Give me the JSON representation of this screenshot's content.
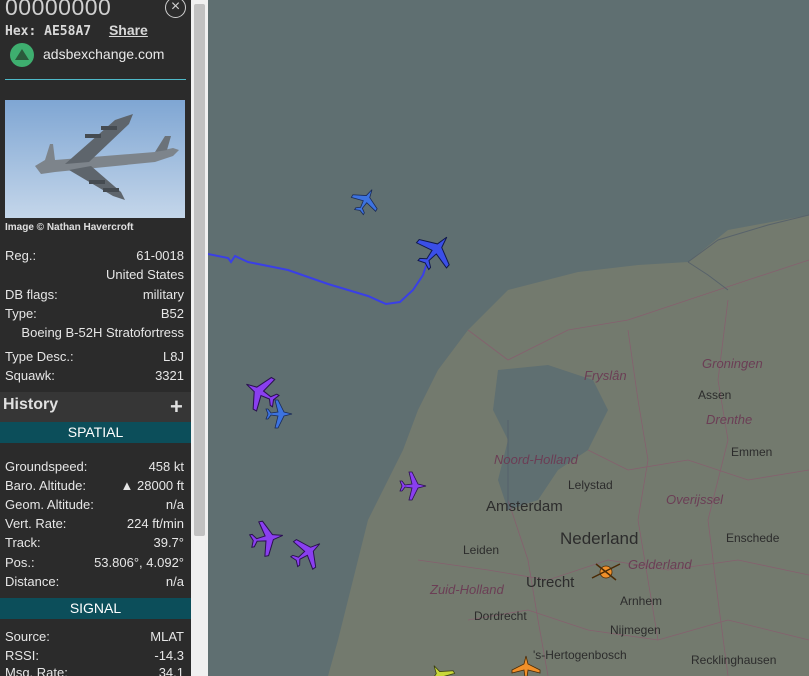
{
  "sidebar": {
    "callsign": "00000000",
    "hex_label": "Hex:",
    "hex": "AE58A7",
    "share": "Share",
    "site": "adsbexchange.com",
    "photo_credit": "Image © Nathan Havercroft",
    "info": [
      {
        "label": "Reg.:",
        "value": "61-0018"
      },
      {
        "label": "",
        "value": "United States"
      },
      {
        "label": "DB flags:",
        "value": "military"
      },
      {
        "label": "Type:",
        "value": "B52"
      },
      {
        "label": "",
        "value": "Boeing B-52H Stratofortress"
      },
      {
        "label": "Type Desc.:",
        "value": "L8J"
      },
      {
        "label": "Squawk:",
        "value": "3321"
      }
    ],
    "history": {
      "title": "History",
      "toggle": "+"
    },
    "spatial": {
      "title": "SPATIAL",
      "rows": [
        {
          "label": "Groundspeed:",
          "value": "458 kt"
        },
        {
          "label": "Baro. Altitude:",
          "value": "▲ 28000 ft"
        },
        {
          "label": "Geom. Altitude:",
          "value": "n/a"
        },
        {
          "label": "Vert. Rate:",
          "value": "224 ft/min"
        },
        {
          "label": "Track:",
          "value": "39.7°"
        },
        {
          "label": "Pos.:",
          "value": "53.806°, 4.092°"
        },
        {
          "label": "Distance:",
          "value": "n/a"
        }
      ]
    },
    "signal": {
      "title": "SIGNAL",
      "rows": [
        {
          "label": "Source:",
          "value": "MLAT"
        },
        {
          "label": "RSSI:",
          "value": "-14.3"
        },
        {
          "label": "Msg. Rate:",
          "value": "34.1"
        }
      ]
    }
  },
  "map": {
    "labels": {
      "frysian": "Fryslân",
      "groningen": "Groningen",
      "assen": "Assen",
      "drenthe": "Drenthe",
      "emmen": "Emmen",
      "noord_holland": "Noord-Holland",
      "lelystad": "Lelystad",
      "overijssel": "Overijssel",
      "amsterdam": "Amsterdam",
      "nederland": "Nederland",
      "enschede": "Enschede",
      "leiden": "Leiden",
      "utrecht": "Utrecht",
      "gelderland": "Gelderland",
      "zuid_holland": "Zuid-Holland",
      "arnhem": "Arnhem",
      "dordrecht": "Dordrecht",
      "nijmegen": "Nijmegen",
      "hertogenbosch": "'s-Hertogenbosch",
      "recklinghausen": "Recklinghausen"
    },
    "colors": {
      "sea": "#5f6f71",
      "land": "#737a6e",
      "track": "#3a3fe6",
      "aircraft_blue": "#3d73e0",
      "aircraft_selected": "#3b4fe8",
      "aircraft_purple": "#8a3ff0",
      "aircraft_orange": "#f0902a",
      "aircraft_yellow": "#c8d83a"
    }
  }
}
